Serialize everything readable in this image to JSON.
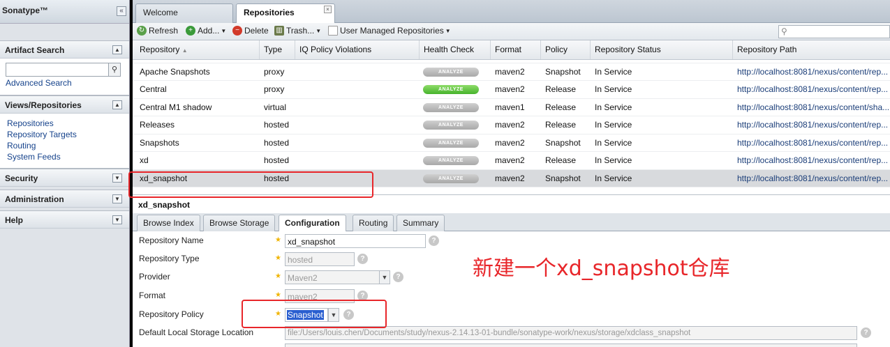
{
  "sidebar": {
    "brand": "Sonatype™",
    "collapse_glyph": "«",
    "artifact_search": {
      "title": "Artifact Search",
      "search_value": "",
      "advanced_link": "Advanced Search"
    },
    "views": {
      "title": "Views/Repositories",
      "links": [
        "Repositories",
        "Repository Targets",
        "Routing",
        "System Feeds"
      ]
    },
    "security": {
      "title": "Security"
    },
    "administration": {
      "title": "Administration"
    },
    "help": {
      "title": "Help"
    }
  },
  "tabs": {
    "welcome": "Welcome",
    "repositories": "Repositories"
  },
  "toolbar": {
    "refresh": "Refresh",
    "add": "Add...",
    "delete": "Delete",
    "trash": "Trash...",
    "user_managed": "User Managed Repositories",
    "search_value": ""
  },
  "grid": {
    "columns": [
      "Repository",
      "Type",
      "IQ Policy Violations",
      "Health Check",
      "Format",
      "Policy",
      "Repository Status",
      "Repository Path"
    ],
    "analyze_label": "ANALYZE",
    "rows": [
      {
        "name": "Apache Snapshots",
        "type": "proxy",
        "format": "maven2",
        "policy": "Snapshot",
        "status": "In Service",
        "path": "http://localhost:8081/nexus/content/rep...",
        "health_green": false
      },
      {
        "name": "Central",
        "type": "proxy",
        "format": "maven2",
        "policy": "Release",
        "status": "In Service",
        "path": "http://localhost:8081/nexus/content/rep...",
        "health_green": true
      },
      {
        "name": "Central M1 shadow",
        "type": "virtual",
        "format": "maven1",
        "policy": "Release",
        "status": "In Service",
        "path": "http://localhost:8081/nexus/content/sha...",
        "health_green": false
      },
      {
        "name": "Releases",
        "type": "hosted",
        "format": "maven2",
        "policy": "Release",
        "status": "In Service",
        "path": "http://localhost:8081/nexus/content/rep...",
        "health_green": false
      },
      {
        "name": "Snapshots",
        "type": "hosted",
        "format": "maven2",
        "policy": "Snapshot",
        "status": "In Service",
        "path": "http://localhost:8081/nexus/content/rep...",
        "health_green": false
      },
      {
        "name": "xd",
        "type": "hosted",
        "format": "maven2",
        "policy": "Release",
        "status": "In Service",
        "path": "http://localhost:8081/nexus/content/rep...",
        "health_green": false
      },
      {
        "name": "xd_snapshot",
        "type": "hosted",
        "format": "maven2",
        "policy": "Snapshot",
        "status": "In Service",
        "path": "http://localhost:8081/nexus/content/rep...",
        "health_green": false
      }
    ]
  },
  "detail": {
    "title": "xd_snapshot",
    "tabs": [
      "Browse Index",
      "Browse Storage",
      "Configuration",
      "Routing",
      "Summary"
    ],
    "active_tab": "Configuration",
    "form": {
      "repo_name_label": "Repository Name",
      "repo_name_value": "xd_snapshot",
      "repo_type_label": "Repository Type",
      "repo_type_value": "hosted",
      "provider_label": "Provider",
      "provider_value": "Maven2",
      "format_label": "Format",
      "format_value": "maven2",
      "policy_label": "Repository Policy",
      "policy_value": "Snapshot",
      "storage_label": "Default Local Storage Location",
      "storage_value": "file:/Users/louis.chen/Documents/study/nexus-2.14.13-01-bundle/sonatype-work/nexus/storage/xdclass_snapshot"
    }
  },
  "annotation": "新建一个xd_snapshot仓库",
  "colors": {
    "highlight": "#e8262a",
    "link": "#15428b",
    "analyze_green": "#46b32c"
  }
}
